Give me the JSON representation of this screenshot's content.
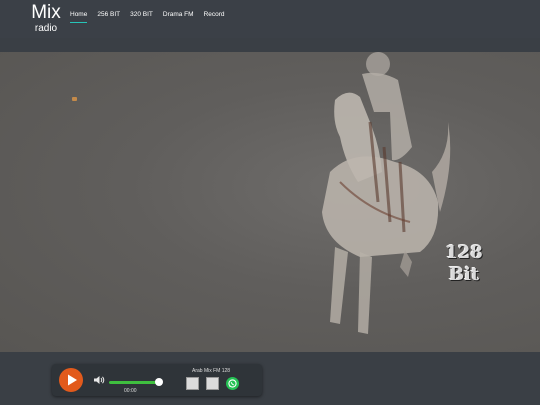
{
  "header": {
    "logo_main": "Mix",
    "logo_sub": "radio",
    "nav": [
      {
        "label": "Home",
        "active": true
      },
      {
        "label": "256 BIT",
        "active": false
      },
      {
        "label": "320 BIT",
        "active": false
      },
      {
        "label": "Drama FM",
        "active": false
      },
      {
        "label": "Record",
        "active": false
      }
    ]
  },
  "scene": {
    "overlay_line1": "128",
    "overlay_line2": "Bit"
  },
  "player": {
    "station_name": "Arab Mix FM 128",
    "time": "00:00",
    "volume_fraction": 1.0,
    "play_icon": "play-icon",
    "volume_icon": "speaker-icon",
    "share_icon": "whatsapp-icon",
    "colors": {
      "play": "#e25a1c",
      "volume_fill": "#3fbf3f",
      "whatsapp": "#25c254",
      "nav_active_underline": "#27c4b8"
    }
  }
}
